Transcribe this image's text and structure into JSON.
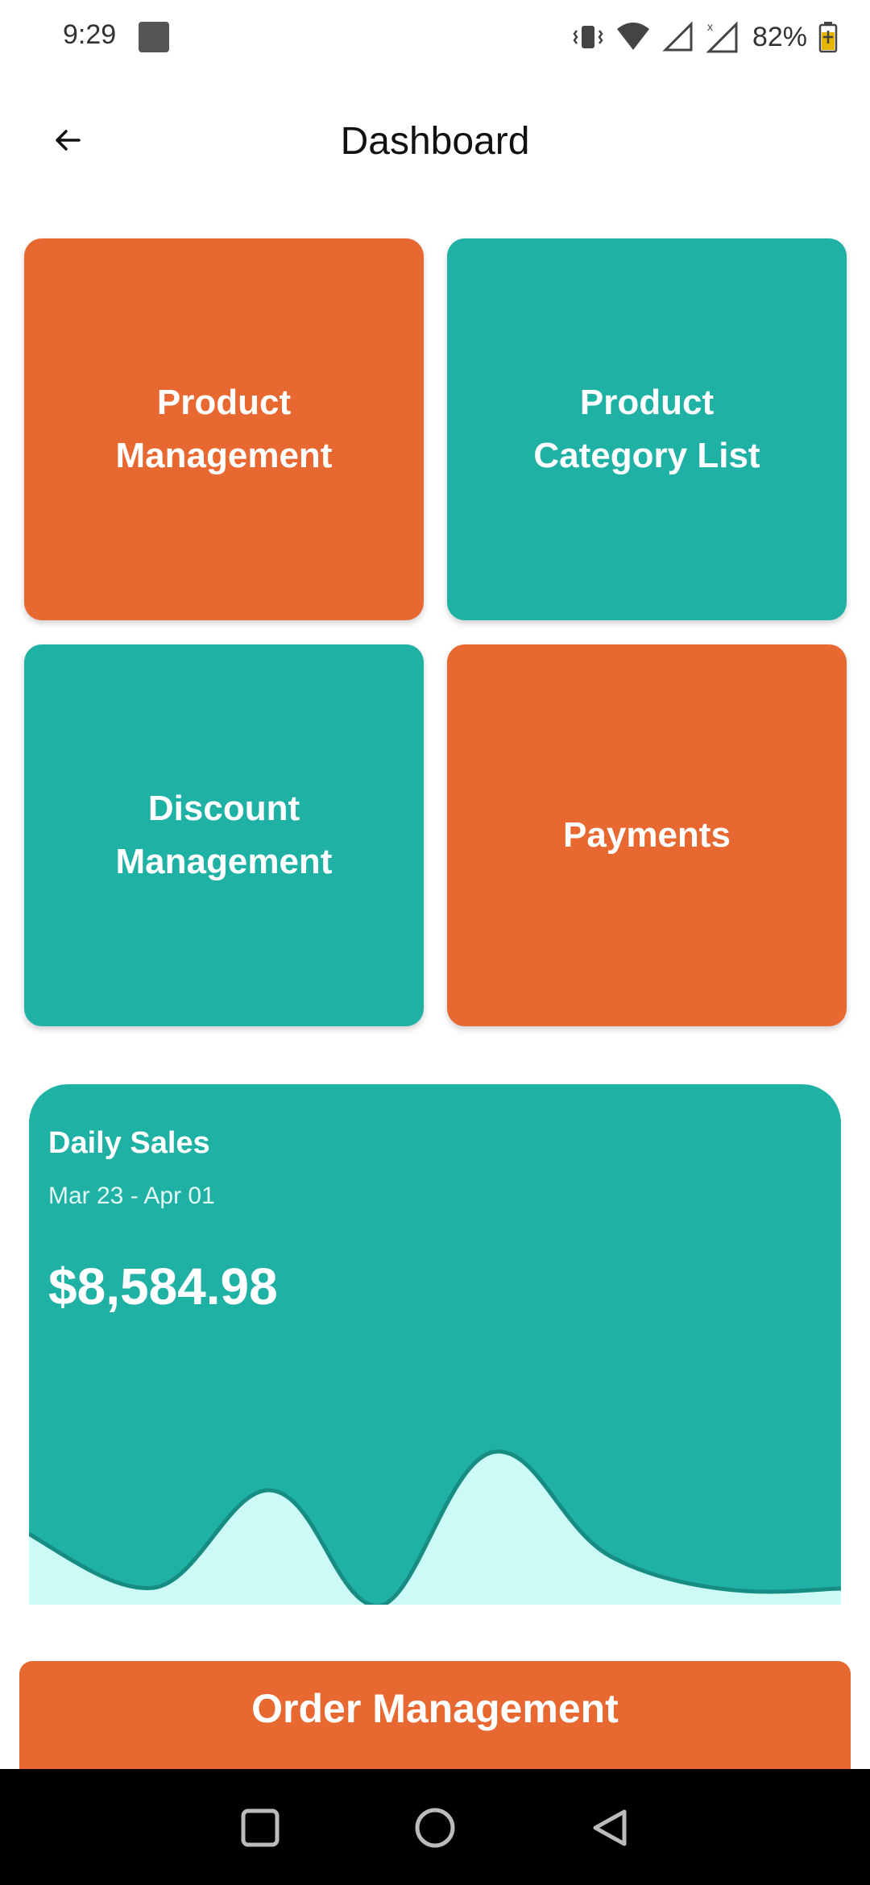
{
  "status_bar": {
    "time": "9:29",
    "battery": "82%"
  },
  "app_bar": {
    "title": "Dashboard",
    "back_icon": "arrow-left-icon"
  },
  "tiles": [
    {
      "label": "Product\nManagement",
      "color": "#E76831"
    },
    {
      "label": "Product\nCategory List",
      "color": "#20B1A5"
    },
    {
      "label": "Discount\nManagement",
      "color": "#20B1A5"
    },
    {
      "label": "Payments",
      "color": "#E76831"
    }
  ],
  "sales_card": {
    "title": "Daily Sales",
    "date_range": "Mar 23 - Apr 01",
    "total": "$8,584.98",
    "colors": {
      "card": "#20B1A5",
      "fill": "#CCFBF7",
      "line": "#168C82"
    }
  },
  "order_button": {
    "label": "Order Management"
  },
  "nav": {
    "recents_icon": "square-icon",
    "home_icon": "circle-icon",
    "back_icon": "triangle-back-icon"
  }
}
